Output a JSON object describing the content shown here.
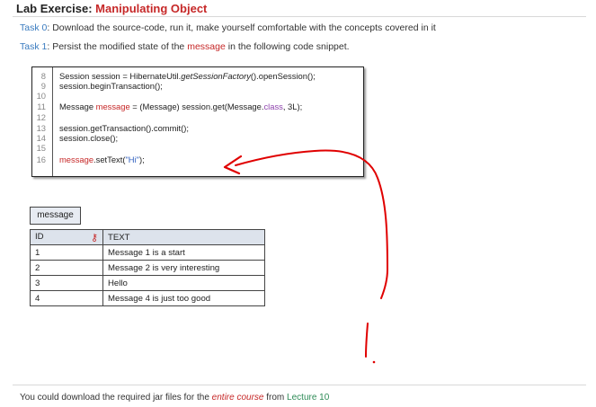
{
  "header": {
    "prefix": "Lab Exercise: ",
    "title": "Manipulating Object"
  },
  "tasks": [
    {
      "label": "Task 0",
      "text": ": Download the source-code, run it, make yourself comfortable with the concepts covered in it"
    },
    {
      "label": "Task 1",
      "pre": ": Persist the modified state of the ",
      "keyword": "message",
      "post": " in the following code snippet."
    }
  ],
  "code": {
    "line_numbers": [
      "8",
      "9",
      "10",
      "11",
      "12",
      "13",
      "14",
      "15",
      "16"
    ],
    "l8": {
      "a": "Session session = HibernateUtil.",
      "b": "getSessionFactory",
      "c": "().openSession();"
    },
    "l9": "session.beginTransaction();",
    "l11": {
      "a": "Message ",
      "b": "message",
      "c": " = (Message) session.get(Message.",
      "d": "class",
      "e": ", 3L);"
    },
    "l13": "session.getTransaction().commit();",
    "l14": "session.close();",
    "l16": {
      "a": "message",
      "b": ".setText(",
      "c": "\"Hi\"",
      "d": ");"
    }
  },
  "table": {
    "name": "message",
    "columns": [
      "ID",
      "TEXT"
    ],
    "rows": [
      [
        "1",
        "Message 1 is a start"
      ],
      [
        "2",
        "Message 2 is very interesting"
      ],
      [
        "3",
        "Hello"
      ],
      [
        "4",
        "Message 4 is just too good"
      ]
    ]
  },
  "footer": {
    "pre": "You could download the required jar files for the ",
    "emphasis": "entire course",
    "mid": " from ",
    "link": "Lecture 10"
  },
  "colors": {
    "accent": "#c62828",
    "link": "#3a7bbf",
    "green": "#2e8b57",
    "annotation": "#e00000"
  },
  "icons": {
    "primary_key": "key-icon"
  }
}
